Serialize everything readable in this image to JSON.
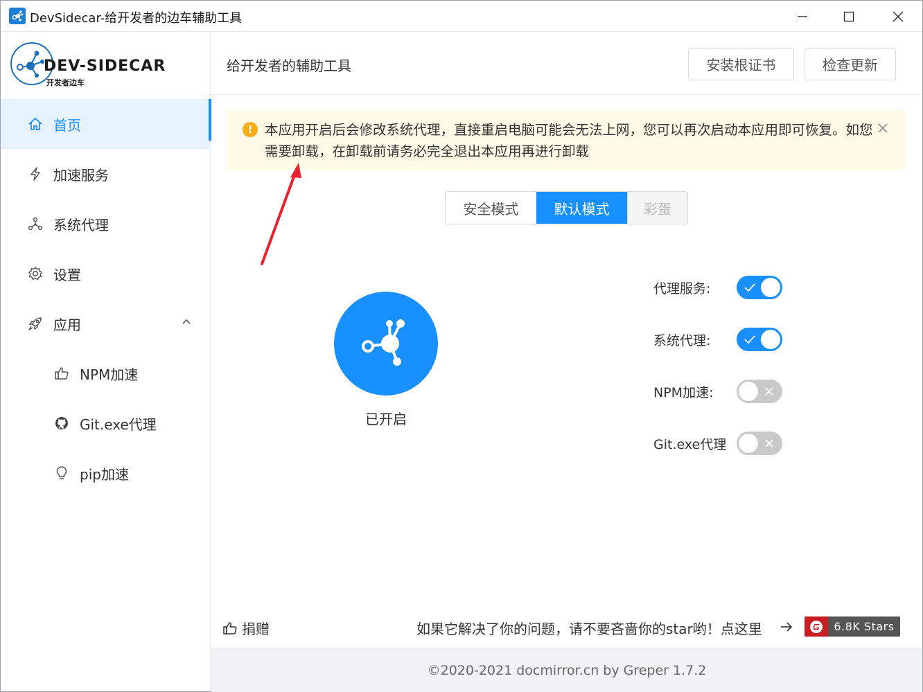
{
  "window": {
    "title": "DevSidecar-给开发者的边车辅助工具"
  },
  "logo": {
    "title": "DEV-SIDECAR",
    "subtitle": "开发者边车"
  },
  "sidebar": {
    "items": [
      {
        "label": "首页",
        "icon": "home-icon",
        "active": true
      },
      {
        "label": "加速服务",
        "icon": "thunderbolt-icon"
      },
      {
        "label": "系统代理",
        "icon": "network-icon"
      },
      {
        "label": "设置",
        "icon": "gear-icon"
      },
      {
        "label": "应用",
        "icon": "rocket-icon",
        "expanded": true
      },
      {
        "label": "NPM加速",
        "icon": "like-icon",
        "sub": true
      },
      {
        "label": "Git.exe代理",
        "icon": "github-icon",
        "sub": true
      },
      {
        "label": "pip加速",
        "icon": "bulb-icon",
        "sub": true
      }
    ]
  },
  "header": {
    "title": "给开发者的辅助工具",
    "install_cert": "安装根证书",
    "check_update": "检查更新"
  },
  "alert": {
    "text": "本应用开启后会修改系统代理，直接重启电脑可能会无法上网，您可以再次启动本应用即可恢复。如您需要卸载，在卸载前请务必完全退出本应用再进行卸载"
  },
  "modes": {
    "safe": "安全模式",
    "default": "默认模式",
    "easter_egg": "彩蛋",
    "selected": "默认模式"
  },
  "power": {
    "status": "已开启"
  },
  "switches": [
    {
      "label": "代理服务:",
      "on": true
    },
    {
      "label": "系统代理:",
      "on": true
    },
    {
      "label": "NPM加速:",
      "on": false
    },
    {
      "label": "Git.exe代理",
      "on": false
    }
  ],
  "footer": {
    "donate": "捐赠",
    "star_text": "如果它解决了你的问题，请不要吝啬你的star哟！点这里",
    "badge": "6.8K Stars",
    "copyright": "©2020-2021 docmirror.cn by Greper  1.7.2"
  },
  "colors": {
    "primary": "#1890ff",
    "alert_bg": "#fffbe6",
    "warning": "#faad14",
    "gitee_red": "#c71d23",
    "arrow_red": "#e8212e"
  }
}
